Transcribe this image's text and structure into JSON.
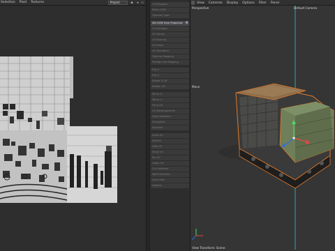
{
  "menubar": {
    "left_items": [
      "Selection",
      "Pixel",
      "Textures"
    ],
    "project_dropdown": "Project",
    "right_items": [
      "View",
      "Cameras",
      "Display",
      "Options",
      "Filter",
      "Panel"
    ]
  },
  "commands": {
    "group1": [
      "UV Polygons",
      "Relax UVW",
      "Optimal Cubic",
      "Set UVW from Projection"
    ],
    "active": "Set UVW from Projection",
    "group2": [
      "UV Manager",
      "UV Terrain",
      "UV Packing",
      "UV Relax",
      "UV Transform",
      "Optimal Mapping",
      "Realign and Mapping"
    ],
    "group3": [
      "Flip U",
      "Flip V",
      "Rotate CCW",
      "Rotate CW"
    ],
    "group4": [
      "Mirror U",
      "Mirror V",
      "Fit to UV",
      "UV Rectangularize",
      "Align Selection",
      "Straighten",
      "Equalize"
    ],
    "group5": [
      "Scale UV",
      "Stretch",
      "Hide UV",
      "Show UV",
      "Pin UV",
      "Unpin UV",
      "Cut Selected",
      "Weld Selected",
      "Grid Lines",
      "Options"
    ]
  },
  "viewport": {
    "view_name": "Perspective",
    "camera_name": "Default Camera",
    "move_label": "Move",
    "status_label": "View Transform: Scene"
  },
  "colors": {
    "selection_outline": "#e07a2a",
    "grid_line": "#25d0c0",
    "axis_y": "#4cd964",
    "axis_z": "#2f6fe0",
    "axis_x": "#e04848",
    "hull_green": "#6f7f5a"
  }
}
